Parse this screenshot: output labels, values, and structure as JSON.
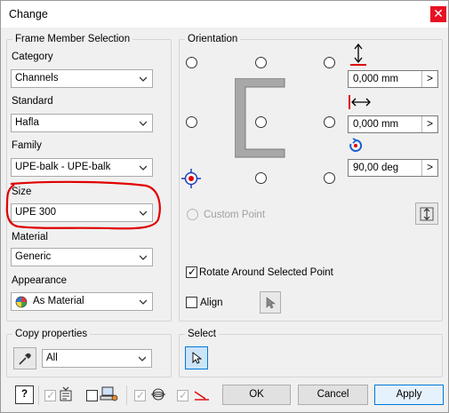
{
  "window": {
    "title": "Change",
    "close_glyph": "✕"
  },
  "frame_member_selection": {
    "title": "Frame Member Selection",
    "category_label": "Category",
    "category_value": "Channels",
    "standard_label": "Standard",
    "standard_value": "Hafla",
    "family_label": "Family",
    "family_value": "UPE-balk - UPE-balk",
    "size_label": "Size",
    "size_value": "UPE 300",
    "material_label": "Material",
    "material_value": "Generic",
    "appearance_label": "Appearance",
    "appearance_value": "As Material"
  },
  "orientation": {
    "title": "Orientation",
    "offset_horizontal": "0,000 mm",
    "offset_vertical": "0,000 mm",
    "rotation": "90,00 deg",
    "field_button_glyph": ">",
    "custom_point_label": "Custom Point",
    "rotate_around_label": "Rotate Around Selected Point",
    "rotate_around_checked": true,
    "align_label": "Align",
    "align_checked": false
  },
  "copy_properties": {
    "title": "Copy properties",
    "value": "All"
  },
  "select": {
    "title": "Select"
  },
  "buttons": {
    "ok": "OK",
    "cancel": "Cancel",
    "apply": "Apply",
    "help_glyph": "?"
  },
  "colors": {
    "accent": "#0078d7",
    "highlight": "#e00000",
    "close": "#e81123",
    "profile": "#a8a8a8"
  }
}
